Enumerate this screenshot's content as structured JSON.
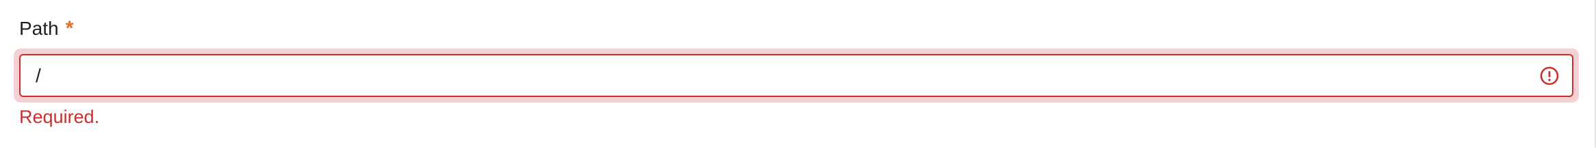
{
  "field": {
    "label": "Path",
    "required_marker": "*",
    "value": "/",
    "error_message": "Required."
  },
  "colors": {
    "error": "#c9302c",
    "error_halo": "#f5d1d5",
    "required_star": "#e0702a"
  },
  "icons": {
    "error": "exclamation-circle-icon"
  }
}
